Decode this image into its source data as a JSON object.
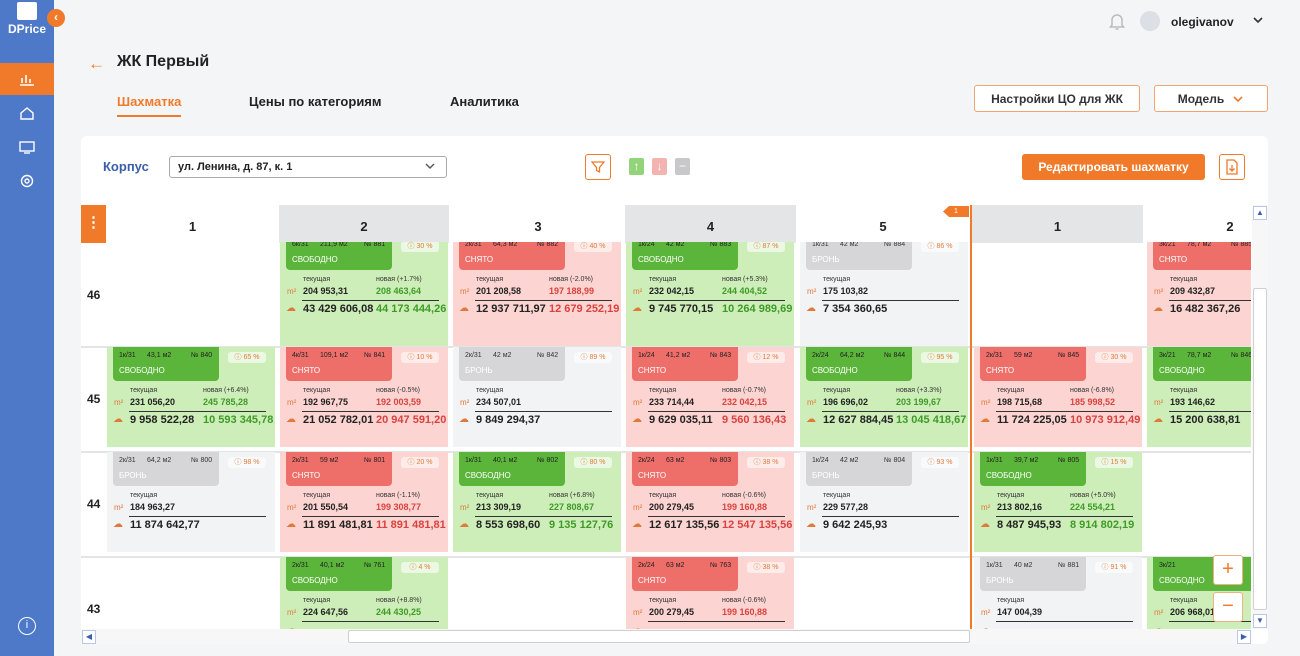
{
  "app": {
    "name": "DPrice"
  },
  "user": {
    "name": "olegivanov"
  },
  "page": {
    "title": "ЖК Первый"
  },
  "tabs": [
    "Шахматка",
    "Цены по категориям",
    "Аналитика"
  ],
  "buttons": {
    "settings": "Настройки ЦО для ЖК",
    "model": "Модель",
    "edit": "Редактировать шахматку"
  },
  "korpus": {
    "label": "Корпус",
    "value": "ул. Ленина, д. 87, к. 1"
  },
  "grid": {
    "columns": [
      "1",
      "2",
      "3",
      "4",
      "5",
      "1",
      "2"
    ],
    "floors": [
      "46",
      "45",
      "44",
      "43"
    ],
    "section_flag": "1",
    "labels": {
      "current": "текущая",
      "new": "новая",
      "m2": "m²"
    }
  },
  "cells": [
    {
      "id": "c46_2",
      "type": "6к/31",
      "area": "211,9 м2",
      "num": "№ 881",
      "status": "СВОБОДНО",
      "pct": "30 %",
      "change": "(+1.7%)",
      "cur": "204 953,31",
      "nw": "208 463,64",
      "tot": "43 429 606,08",
      "ntot": "44 173 444,26"
    },
    {
      "id": "c46_3",
      "type": "2к/31",
      "area": "64,3 м2",
      "num": "№ 882",
      "status": "СНЯТО",
      "pct": "40 %",
      "change": "(-2.0%)",
      "cur": "201 208,58",
      "nw": "197 188,99",
      "tot": "12 937 711,97",
      "ntot": "12 679 252,19"
    },
    {
      "id": "c46_4",
      "type": "1к/24",
      "area": "42 м2",
      "num": "№ 883",
      "status": "СВОБОДНО",
      "pct": "87 %",
      "change": "(+5.3%)",
      "cur": "232 042,15",
      "nw": "244 404,52",
      "tot": "9 745 770,15",
      "ntot": "10 264 989,69"
    },
    {
      "id": "c46_5",
      "type": "1к/31",
      "area": "42 м2",
      "num": "№ 884",
      "status": "БРОНЬ",
      "pct": "86 %",
      "change": "",
      "cur": "175 103,82",
      "nw": "",
      "tot": "7 354 360,65",
      "ntot": ""
    },
    {
      "id": "c46_7",
      "type": "3к/21",
      "area": "78,7 м2",
      "num": "№ 885",
      "status": "СНЯТО",
      "pct": "",
      "change": "",
      "cur": "209 432,87",
      "nw": "",
      "tot": "16 482 367,26",
      "ntot": ""
    },
    {
      "id": "c45_1",
      "type": "1к/31",
      "area": "43,1 м2",
      "num": "№ 840",
      "status": "СВОБОДНО",
      "pct": "65 %",
      "change": "(+6.4%)",
      "cur": "231 056,20",
      "nw": "245 785,28",
      "tot": "9 958 522,28",
      "ntot": "10 593 345,78"
    },
    {
      "id": "c45_2",
      "type": "4к/31",
      "area": "109,1 м2",
      "num": "№ 841",
      "status": "СНЯТО",
      "pct": "10 %",
      "change": "(-0.5%)",
      "cur": "192 967,75",
      "nw": "192 003,59",
      "tot": "21 052 782,01",
      "ntot": "20 947 591,20"
    },
    {
      "id": "c45_3",
      "type": "2к/31",
      "area": "42 м2",
      "num": "№ 842",
      "status": "БРОНЬ",
      "pct": "89 %",
      "change": "",
      "cur": "234 507,01",
      "nw": "",
      "tot": "9 849 294,37",
      "ntot": ""
    },
    {
      "id": "c45_4",
      "type": "1к/24",
      "area": "41,2 м2",
      "num": "№ 843",
      "status": "СНЯТО",
      "pct": "12 %",
      "change": "(-0.7%)",
      "cur": "233 714,44",
      "nw": "232 042,15",
      "tot": "9 629 035,11",
      "ntot": "9 560 136,43"
    },
    {
      "id": "c45_5",
      "type": "2к/24",
      "area": "64,2 м2",
      "num": "№ 844",
      "status": "СВОБОДНО",
      "pct": "95 %",
      "change": "(+3.3%)",
      "cur": "196 696,02",
      "nw": "203 199,67",
      "tot": "12 627 884,45",
      "ntot": "13 045 418,67"
    },
    {
      "id": "c45_6",
      "type": "2к/31",
      "area": "59 м2",
      "num": "№ 845",
      "status": "СНЯТО",
      "pct": "30 %",
      "change": "(-6.8%)",
      "cur": "198 715,68",
      "nw": "185 998,52",
      "tot": "11 724 225,05",
      "ntot": "10 973 912,49"
    },
    {
      "id": "c45_7",
      "type": "3к/21",
      "area": "78,7 м2",
      "num": "№ 846",
      "status": "СВОБОДНО",
      "pct": "",
      "change": "",
      "cur": "193 146,62",
      "nw": "",
      "tot": "15 200 638,81",
      "ntot": ""
    },
    {
      "id": "c44_1",
      "type": "2к/31",
      "area": "64,2 м2",
      "num": "№ 800",
      "status": "БРОНЬ",
      "pct": "98 %",
      "change": "",
      "cur": "184 963,27",
      "nw": "",
      "tot": "11 874 642,77",
      "ntot": ""
    },
    {
      "id": "c44_2",
      "type": "2к/31",
      "area": "59 м2",
      "num": "№ 801",
      "status": "СНЯТО",
      "pct": "20 %",
      "change": "(-1.1%)",
      "cur": "201 550,54",
      "nw": "199 308,77",
      "tot": "11 891 481,81",
      "ntot": "11 891 481,81"
    },
    {
      "id": "c44_3",
      "type": "1к/31",
      "area": "40,1 м2",
      "num": "№ 802",
      "status": "СВОБОДНО",
      "pct": "80 %",
      "change": "(+6.8%)",
      "cur": "213 309,19",
      "nw": "227 808,67",
      "tot": "8 553 698,60",
      "ntot": "9 135 127,76"
    },
    {
      "id": "c44_4",
      "type": "2к/24",
      "area": "63 м2",
      "num": "№ 803",
      "status": "СНЯТО",
      "pct": "38 %",
      "change": "(-0.6%)",
      "cur": "200 279,45",
      "nw": "199 160,88",
      "tot": "12 617 135,56",
      "ntot": "12 547 135,56"
    },
    {
      "id": "c44_5",
      "type": "1к/24",
      "area": "42 м2",
      "num": "№ 804",
      "status": "БРОНЬ",
      "pct": "93 %",
      "change": "",
      "cur": "229 577,28",
      "nw": "",
      "tot": "9 642 245,93",
      "ntot": ""
    },
    {
      "id": "c44_6",
      "type": "1к/31",
      "area": "39,7 м2",
      "num": "№ 805",
      "status": "СВОБОДНО",
      "pct": "15 %",
      "change": "(+5.0%)",
      "cur": "213 802,16",
      "nw": "224 554,21",
      "tot": "8 487 945,93",
      "ntot": "8 914 802,19"
    },
    {
      "id": "c43_2",
      "type": "2к/31",
      "area": "40,1 м2",
      "num": "№ 761",
      "status": "СВОБОДНО",
      "pct": "4 %",
      "change": "(+8.8%)",
      "cur": "224 647,56",
      "nw": "244 430,25",
      "tot": "",
      "ntot": ""
    },
    {
      "id": "c43_4",
      "type": "2к/24",
      "area": "63 м2",
      "num": "№ 763",
      "status": "СНЯТО",
      "pct": "38 %",
      "change": "(-0.6%)",
      "cur": "200 279,45",
      "nw": "199 160,88",
      "tot": "",
      "ntot": ""
    },
    {
      "id": "c43_6",
      "type": "1к/31",
      "area": "40 м2",
      "num": "№ 881",
      "status": "БРОНЬ",
      "pct": "91 %",
      "change": "",
      "cur": "147 004,39",
      "nw": "",
      "tot": "",
      "ntot": ""
    },
    {
      "id": "c43_7",
      "type": "3к/21",
      "area": "",
      "num": "",
      "status": "СВОБОДНО",
      "pct": "",
      "change": "",
      "cur": "206 968,01",
      "nw": "",
      "tot": "",
      "ntot": ""
    }
  ]
}
